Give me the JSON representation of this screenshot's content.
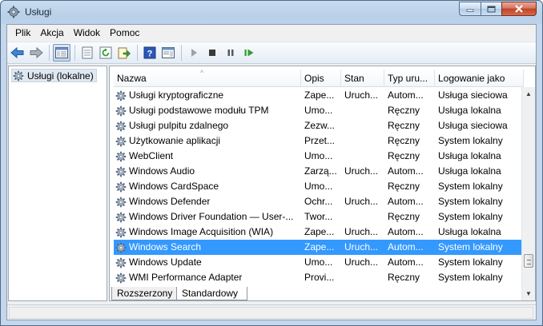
{
  "window": {
    "title": "Usługi"
  },
  "menu": [
    "Plik",
    "Akcja",
    "Widok",
    "Pomoc"
  ],
  "toolbar": {
    "buttons": [
      "back-arrow",
      "forward-arrow",
      "show-hide-console-tree",
      "properties",
      "refresh",
      "export-list",
      "help",
      "show-action-pane",
      "start-service",
      "stop-service",
      "pause-service",
      "restart-service"
    ]
  },
  "tree": {
    "root": "Usługi (lokalne)"
  },
  "columns": [
    "Nazwa",
    "Opis",
    "Stan",
    "Typ uru...",
    "Logowanie jako"
  ],
  "services": [
    {
      "name": "Usługi kryptograficzne",
      "desc": "Zape...",
      "state": "Uruch...",
      "startup": "Autom...",
      "logon": "Usługa sieciowa"
    },
    {
      "name": "Usługi podstawowe modułu TPM",
      "desc": "Umo...",
      "state": "",
      "startup": "Ręczny",
      "logon": "Usługa lokalna"
    },
    {
      "name": "Usługi pulpitu zdalnego",
      "desc": "Zezw...",
      "state": "",
      "startup": "Ręczny",
      "logon": "Usługa sieciowa"
    },
    {
      "name": "Użytkowanie aplikacji",
      "desc": "Przet...",
      "state": "",
      "startup": "Ręczny",
      "logon": "System lokalny"
    },
    {
      "name": "WebClient",
      "desc": "Umo...",
      "state": "",
      "startup": "Ręczny",
      "logon": "Usługa lokalna"
    },
    {
      "name": "Windows Audio",
      "desc": "Zarzą...",
      "state": "Uruch...",
      "startup": "Autom...",
      "logon": "Usługa lokalna"
    },
    {
      "name": "Windows CardSpace",
      "desc": "Umo...",
      "state": "",
      "startup": "Ręczny",
      "logon": "System lokalny"
    },
    {
      "name": "Windows Defender",
      "desc": "Ochr...",
      "state": "Uruch...",
      "startup": "Autom...",
      "logon": "System lokalny"
    },
    {
      "name": "Windows Driver Foundation — User-...",
      "desc": "Twor...",
      "state": "",
      "startup": "Ręczny",
      "logon": "System lokalny"
    },
    {
      "name": "Windows Image Acquisition (WIA)",
      "desc": "Zape...",
      "state": "Uruch...",
      "startup": "Autom...",
      "logon": "Usługa lokalna"
    },
    {
      "name": "Windows Search",
      "desc": "Zape...",
      "state": "Uruch...",
      "startup": "Autom...",
      "logon": "System lokalny",
      "selected": true
    },
    {
      "name": "Windows Update",
      "desc": "Umo...",
      "state": "Uruch...",
      "startup": "Autom...",
      "logon": "System lokalny"
    },
    {
      "name": "WMI Performance Adapter",
      "desc": "Provi...",
      "state": "",
      "startup": "Ręczny",
      "logon": "System lokalny"
    }
  ],
  "tabs": [
    "Rozszerzony",
    "Standardowy"
  ],
  "colors": {
    "selection": "#3399ff",
    "toolbar_start": "#2f9f2f",
    "help": "#2b57b8"
  }
}
